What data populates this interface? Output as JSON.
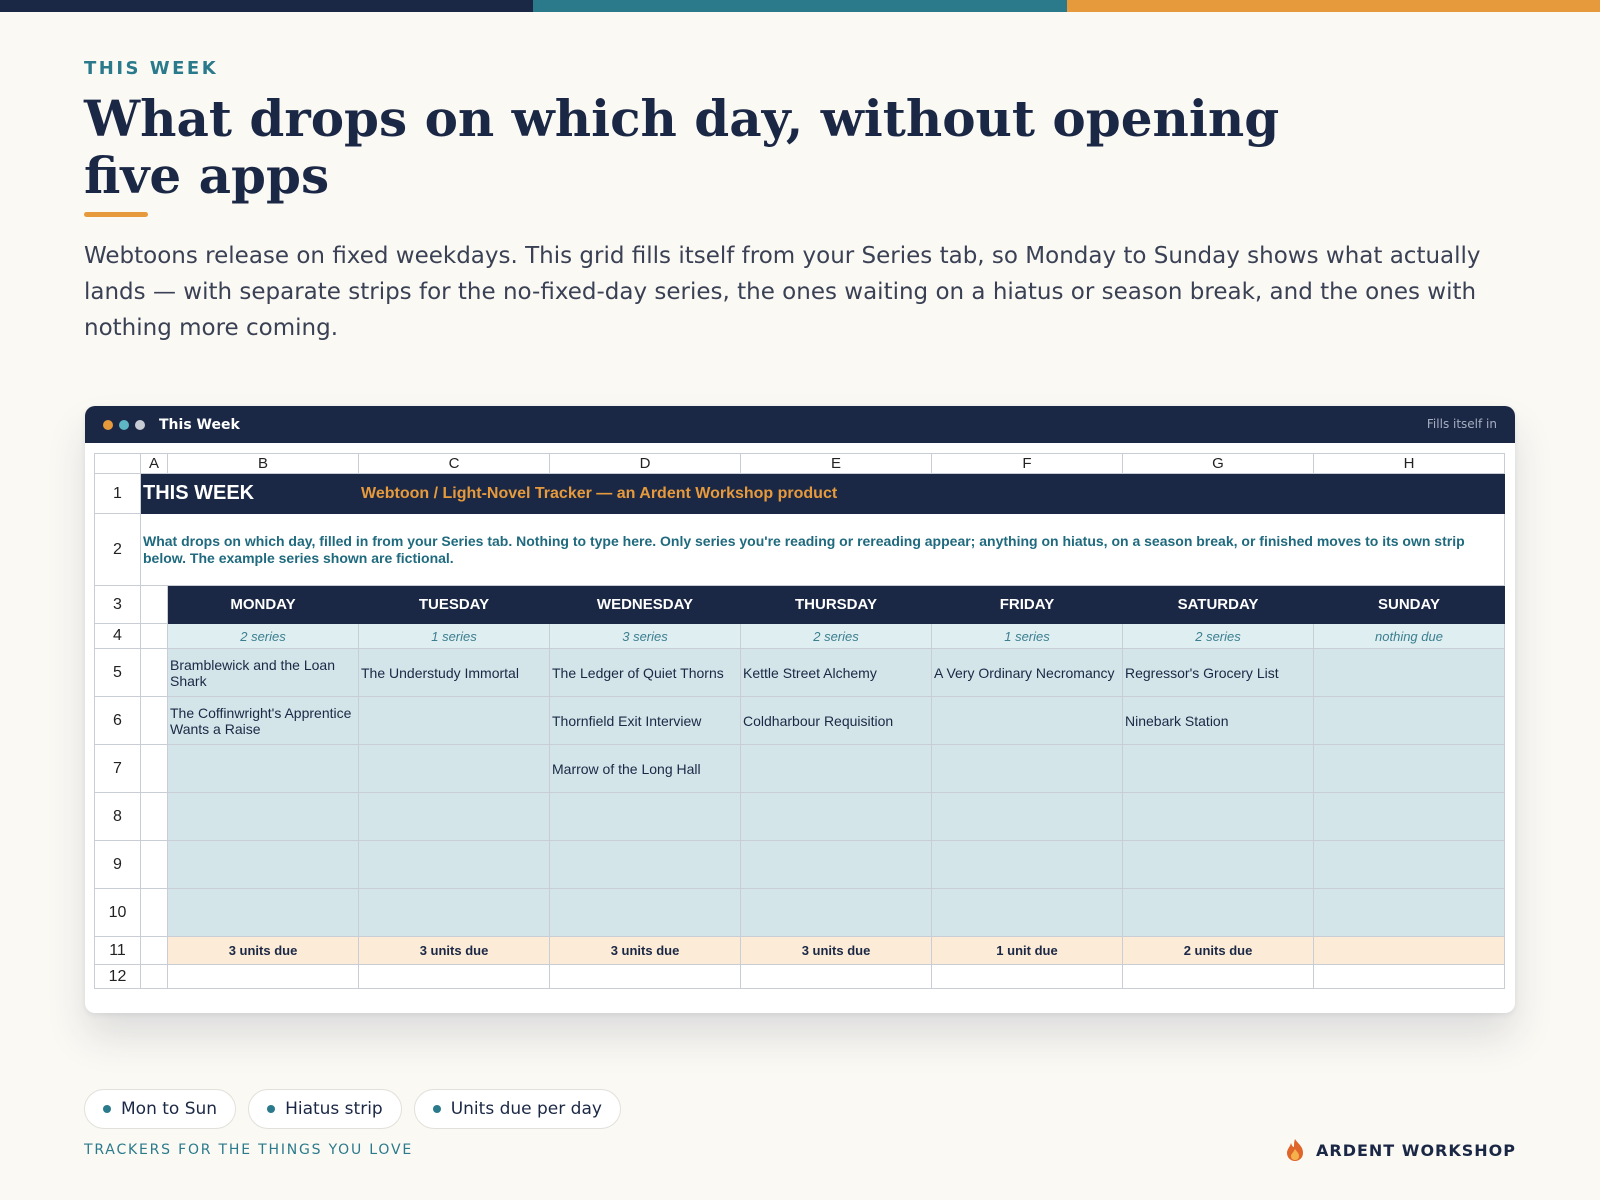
{
  "colors": {
    "navy": "#1b2845",
    "teal": "#2b7a8c",
    "orange": "#e79a3c",
    "cream": "#fbf9f4",
    "cell_teal": "#d3e5e9",
    "units_peach": "#fcebd7"
  },
  "eyebrow": "THIS WEEK",
  "headline": "What drops on which day, without opening five apps",
  "intro": "Webtoons release on fixed weekdays. This grid fills itself from your Series tab, so Monday to Sunday shows what actually lands — with separate strips for the no-fixed-day series, the ones waiting on a hiatus or season break, and the ones with nothing more coming.",
  "window": {
    "title": "This Week",
    "right_label": "Fills itself in",
    "dots": [
      "#e79a3c",
      "#5fb6c4",
      "#c8ccd4"
    ]
  },
  "sheet": {
    "column_letters": [
      "A",
      "B",
      "C",
      "D",
      "E",
      "F",
      "G",
      "H"
    ],
    "row_numbers": [
      "1",
      "2",
      "3",
      "4",
      "5",
      "6",
      "7",
      "8",
      "9",
      "10",
      "11",
      "12"
    ],
    "banner_title": "THIS WEEK",
    "banner_subtitle": "Webtoon / Light-Novel Tracker — an Ardent Workshop product",
    "description": "What drops on which day, filled in from your Series tab. Nothing to type here. Only series you're reading or rereading appear; anything on hiatus, on a season break, or finished moves to its own strip below. The example series shown are fictional.",
    "days": [
      "MONDAY",
      "TUESDAY",
      "WEDNESDAY",
      "THURSDAY",
      "FRIDAY",
      "SATURDAY",
      "SUNDAY"
    ],
    "counts": [
      "2 series",
      "1 series",
      "3 series",
      "2 series",
      "1 series",
      "2 series",
      "nothing due"
    ],
    "rows": [
      [
        "Bramblewick and the Loan Shark",
        "The Understudy Immortal",
        "The Ledger of Quiet Thorns",
        "Kettle Street Alchemy",
        "A Very Ordinary Necromancy",
        "Regressor's Grocery List",
        ""
      ],
      [
        "The Coffinwright's Apprentice Wants a Raise",
        "",
        "Thornfield Exit Interview",
        "Coldharbour Requisition",
        "",
        "Ninebark Station",
        ""
      ],
      [
        "",
        "",
        "Marrow of the Long Hall",
        "",
        "",
        "",
        ""
      ],
      [
        "",
        "",
        "",
        "",
        "",
        "",
        ""
      ],
      [
        "",
        "",
        "",
        "",
        "",
        "",
        ""
      ],
      [
        "",
        "",
        "",
        "",
        "",
        "",
        ""
      ]
    ],
    "units_due": [
      "3 units due",
      "3 units due",
      "3 units due",
      "3 units due",
      "1 unit due",
      "2 units due",
      ""
    ]
  },
  "chips": [
    "Mon to Sun",
    "Hiatus strip",
    "Units due per day"
  ],
  "tagline": "TRACKERS FOR THE THINGS YOU LOVE",
  "brand": {
    "name": "ARDENT WORKSHOP",
    "icon": "flame-icon"
  }
}
